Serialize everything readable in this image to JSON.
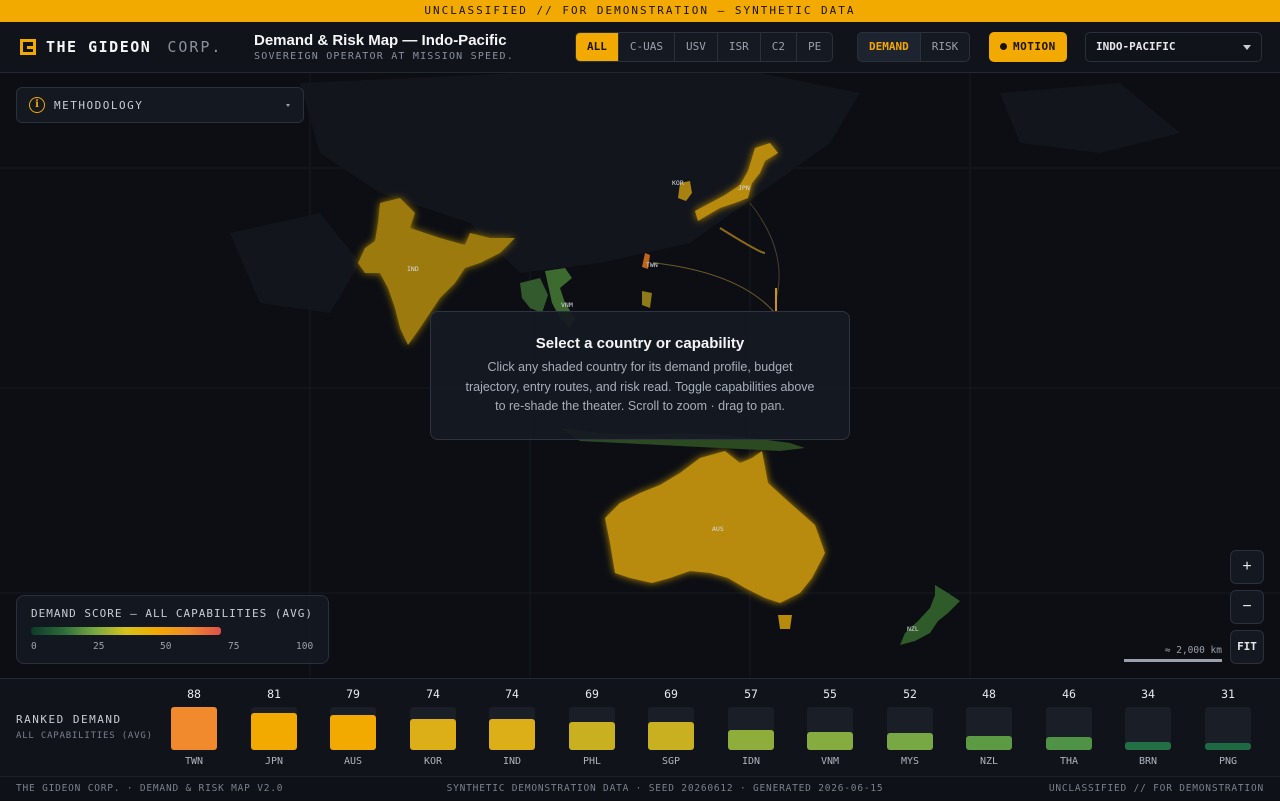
{
  "banner": "UNCLASSIFIED // FOR DEMONSTRATION — SYNTHETIC DATA",
  "brand": {
    "name": "THE GIDEON",
    "suffix": "CORP."
  },
  "header": {
    "title": "Demand & Risk Map — Indo-Pacific",
    "subtitle": "SOVEREIGN OPERATOR AT MISSION SPEED."
  },
  "capabilities": {
    "options": [
      "ALL",
      "C-UAS",
      "USV",
      "ISR",
      "C2",
      "PE"
    ],
    "selected": "ALL"
  },
  "modes": {
    "options": [
      "DEMAND",
      "RISK"
    ],
    "selected": "DEMAND"
  },
  "motion_label": "MOTION",
  "theater_select": {
    "value": "INDO-PACIFIC"
  },
  "methodology_label": "METHODOLOGY",
  "prompt": {
    "title": "Select a country or capability",
    "body": "Click any shaded country for its demand profile, budget trajectory, entry routes, and risk read. Toggle capabilities above to re-shade the theater. Scroll to zoom · drag to pan."
  },
  "map_labels": [
    "IND",
    "KOR",
    "JPN",
    "TWN",
    "VNM",
    "AUS",
    "NZL"
  ],
  "legend": {
    "title": "DEMAND SCORE — ALL CAPABILITIES (AVG)",
    "ticks": [
      "0",
      "25",
      "50",
      "75",
      "100"
    ]
  },
  "controls": {
    "zoom_in": "+",
    "zoom_out": "−",
    "fit": "FIT",
    "scale": "≈ 2,000 km"
  },
  "ranked": {
    "title": "RANKED DEMAND",
    "subtitle": "ALL CAPABILITIES (AVG)",
    "items": [
      {
        "code": "TWN",
        "value": 88,
        "color": "#f08a2c"
      },
      {
        "code": "JPN",
        "value": 81,
        "color": "#f2a900"
      },
      {
        "code": "AUS",
        "value": 79,
        "color": "#f2a900"
      },
      {
        "code": "KOR",
        "value": 74,
        "color": "#dcae18"
      },
      {
        "code": "IND",
        "value": 74,
        "color": "#dcae18"
      },
      {
        "code": "PHL",
        "value": 69,
        "color": "#c8b020"
      },
      {
        "code": "SGP",
        "value": 69,
        "color": "#c8b020"
      },
      {
        "code": "IDN",
        "value": 57,
        "color": "#8fad3a"
      },
      {
        "code": "VNM",
        "value": 55,
        "color": "#86ab3e"
      },
      {
        "code": "MYS",
        "value": 52,
        "color": "#78a843"
      },
      {
        "code": "NZL",
        "value": 48,
        "color": "#5c9a44"
      },
      {
        "code": "THA",
        "value": 46,
        "color": "#4f9446"
      },
      {
        "code": "BRN",
        "value": 34,
        "color": "#237046"
      },
      {
        "code": "PNG",
        "value": 31,
        "color": "#1f6a44"
      }
    ]
  },
  "footer": {
    "left": "THE GIDEON CORP. · DEMAND & RISK MAP V2.0",
    "center": "SYNTHETIC DEMONSTRATION DATA · SEED 20260612 · GENERATED 2026-06-15",
    "right": "UNCLASSIFIED // FOR DEMONSTRATION"
  }
}
